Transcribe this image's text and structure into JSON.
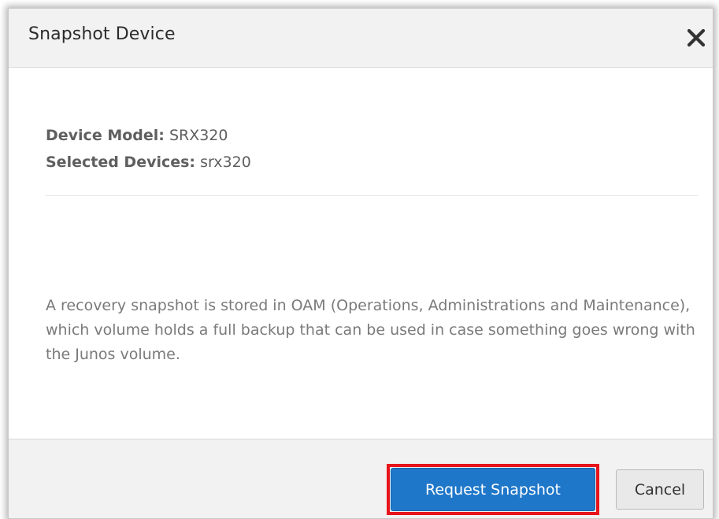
{
  "dialog": {
    "title": "Snapshot Device",
    "close_icon": "close-icon"
  },
  "info": {
    "model_label": "Device Model:",
    "model_value": "SRX320",
    "devices_label": "Selected Devices:",
    "devices_value": "srx320"
  },
  "description": "A recovery snapshot is stored in OAM (Operations, Administrations and Maintenance), which volume holds a full backup that can be used in case something goes wrong with the Junos volume.",
  "footer": {
    "primary_label": "Request Snapshot",
    "secondary_label": "Cancel"
  },
  "colors": {
    "primary": "#1f77c9",
    "highlight": "#e8141c",
    "header_bg": "#f2f2f2"
  }
}
